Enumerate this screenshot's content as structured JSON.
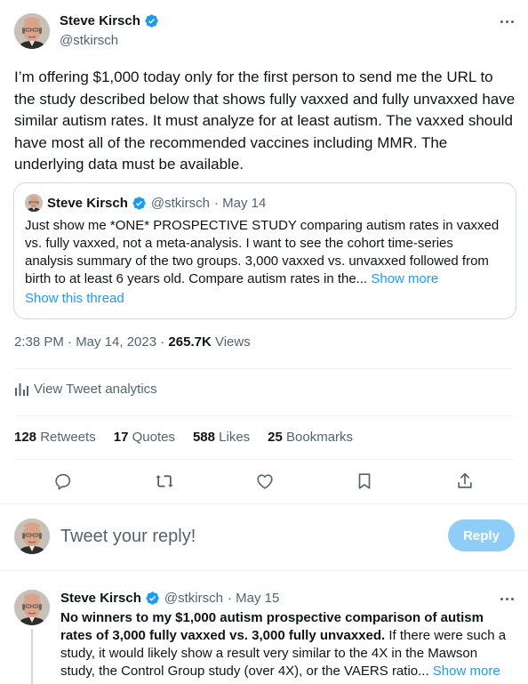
{
  "tweet": {
    "author_name": "Steve Kirsch",
    "author_handle": "@stkirsch",
    "text": "I’m offering $1,000 today only for the first person to send me the URL to the study described below that shows fully vaxxed and fully unvaxxed have similar autism rates. It must analyze for at least autism. The vaxxed should have most all of the recommended vaccines including MMR. The underlying data must be available.",
    "timestamp": "2:38 PM · May 14, 2023 · ",
    "views_count": "265.7K",
    "views_label": " Views",
    "analytics_label": "View Tweet analytics"
  },
  "quote": {
    "author_name": "Steve Kirsch",
    "author_handle": "@stkirsch",
    "date": "· May 14",
    "text": "Just show me *ONE* PROSPECTIVE STUDY comparing autism rates in vaxxed vs. fully vaxxed, not a meta-analysis. I want to see the cohort time-series analysis summary of the two groups. 3,000 vaxxed vs. unvaxxed followed from birth to at least 6 years old. Compare autism rates in the... ",
    "show_more": "Show more",
    "show_thread": "Show this thread"
  },
  "stats": {
    "retweets_count": "128",
    "retweets_label": " Retweets",
    "quotes_count": "17",
    "quotes_label": " Quotes",
    "likes_count": "588",
    "likes_label": " Likes",
    "bookmarks_count": "25",
    "bookmarks_label": " Bookmarks"
  },
  "reply_box": {
    "placeholder": "Tweet your reply!",
    "button_label": "Reply"
  },
  "reply_tweet": {
    "author_name": "Steve Kirsch",
    "author_handle": "@stkirsch",
    "date": "· May 15",
    "text_bold": "No winners to my $1,000 autism prospective comparison of autism rates of 3,000 fully vaxxed vs. 3,000 fully unvaxxed.",
    "text_rest": " If there were such a study, it would likely show a result very similar to the 4X in the Mawson study, the Control Group study (over 4X), or the VAERS ratio... ",
    "show_more": "Show more"
  },
  "icons": [
    "verified-badge-icon",
    "more-options-icon",
    "analytics-icon",
    "reply-icon",
    "retweet-icon",
    "like-icon",
    "bookmark-icon",
    "share-icon"
  ],
  "colors": {
    "accent": "#1d9bf0",
    "reply_button_disabled": "#8ecdf8",
    "secondary_text": "#536471",
    "divider": "#eff3f4"
  }
}
